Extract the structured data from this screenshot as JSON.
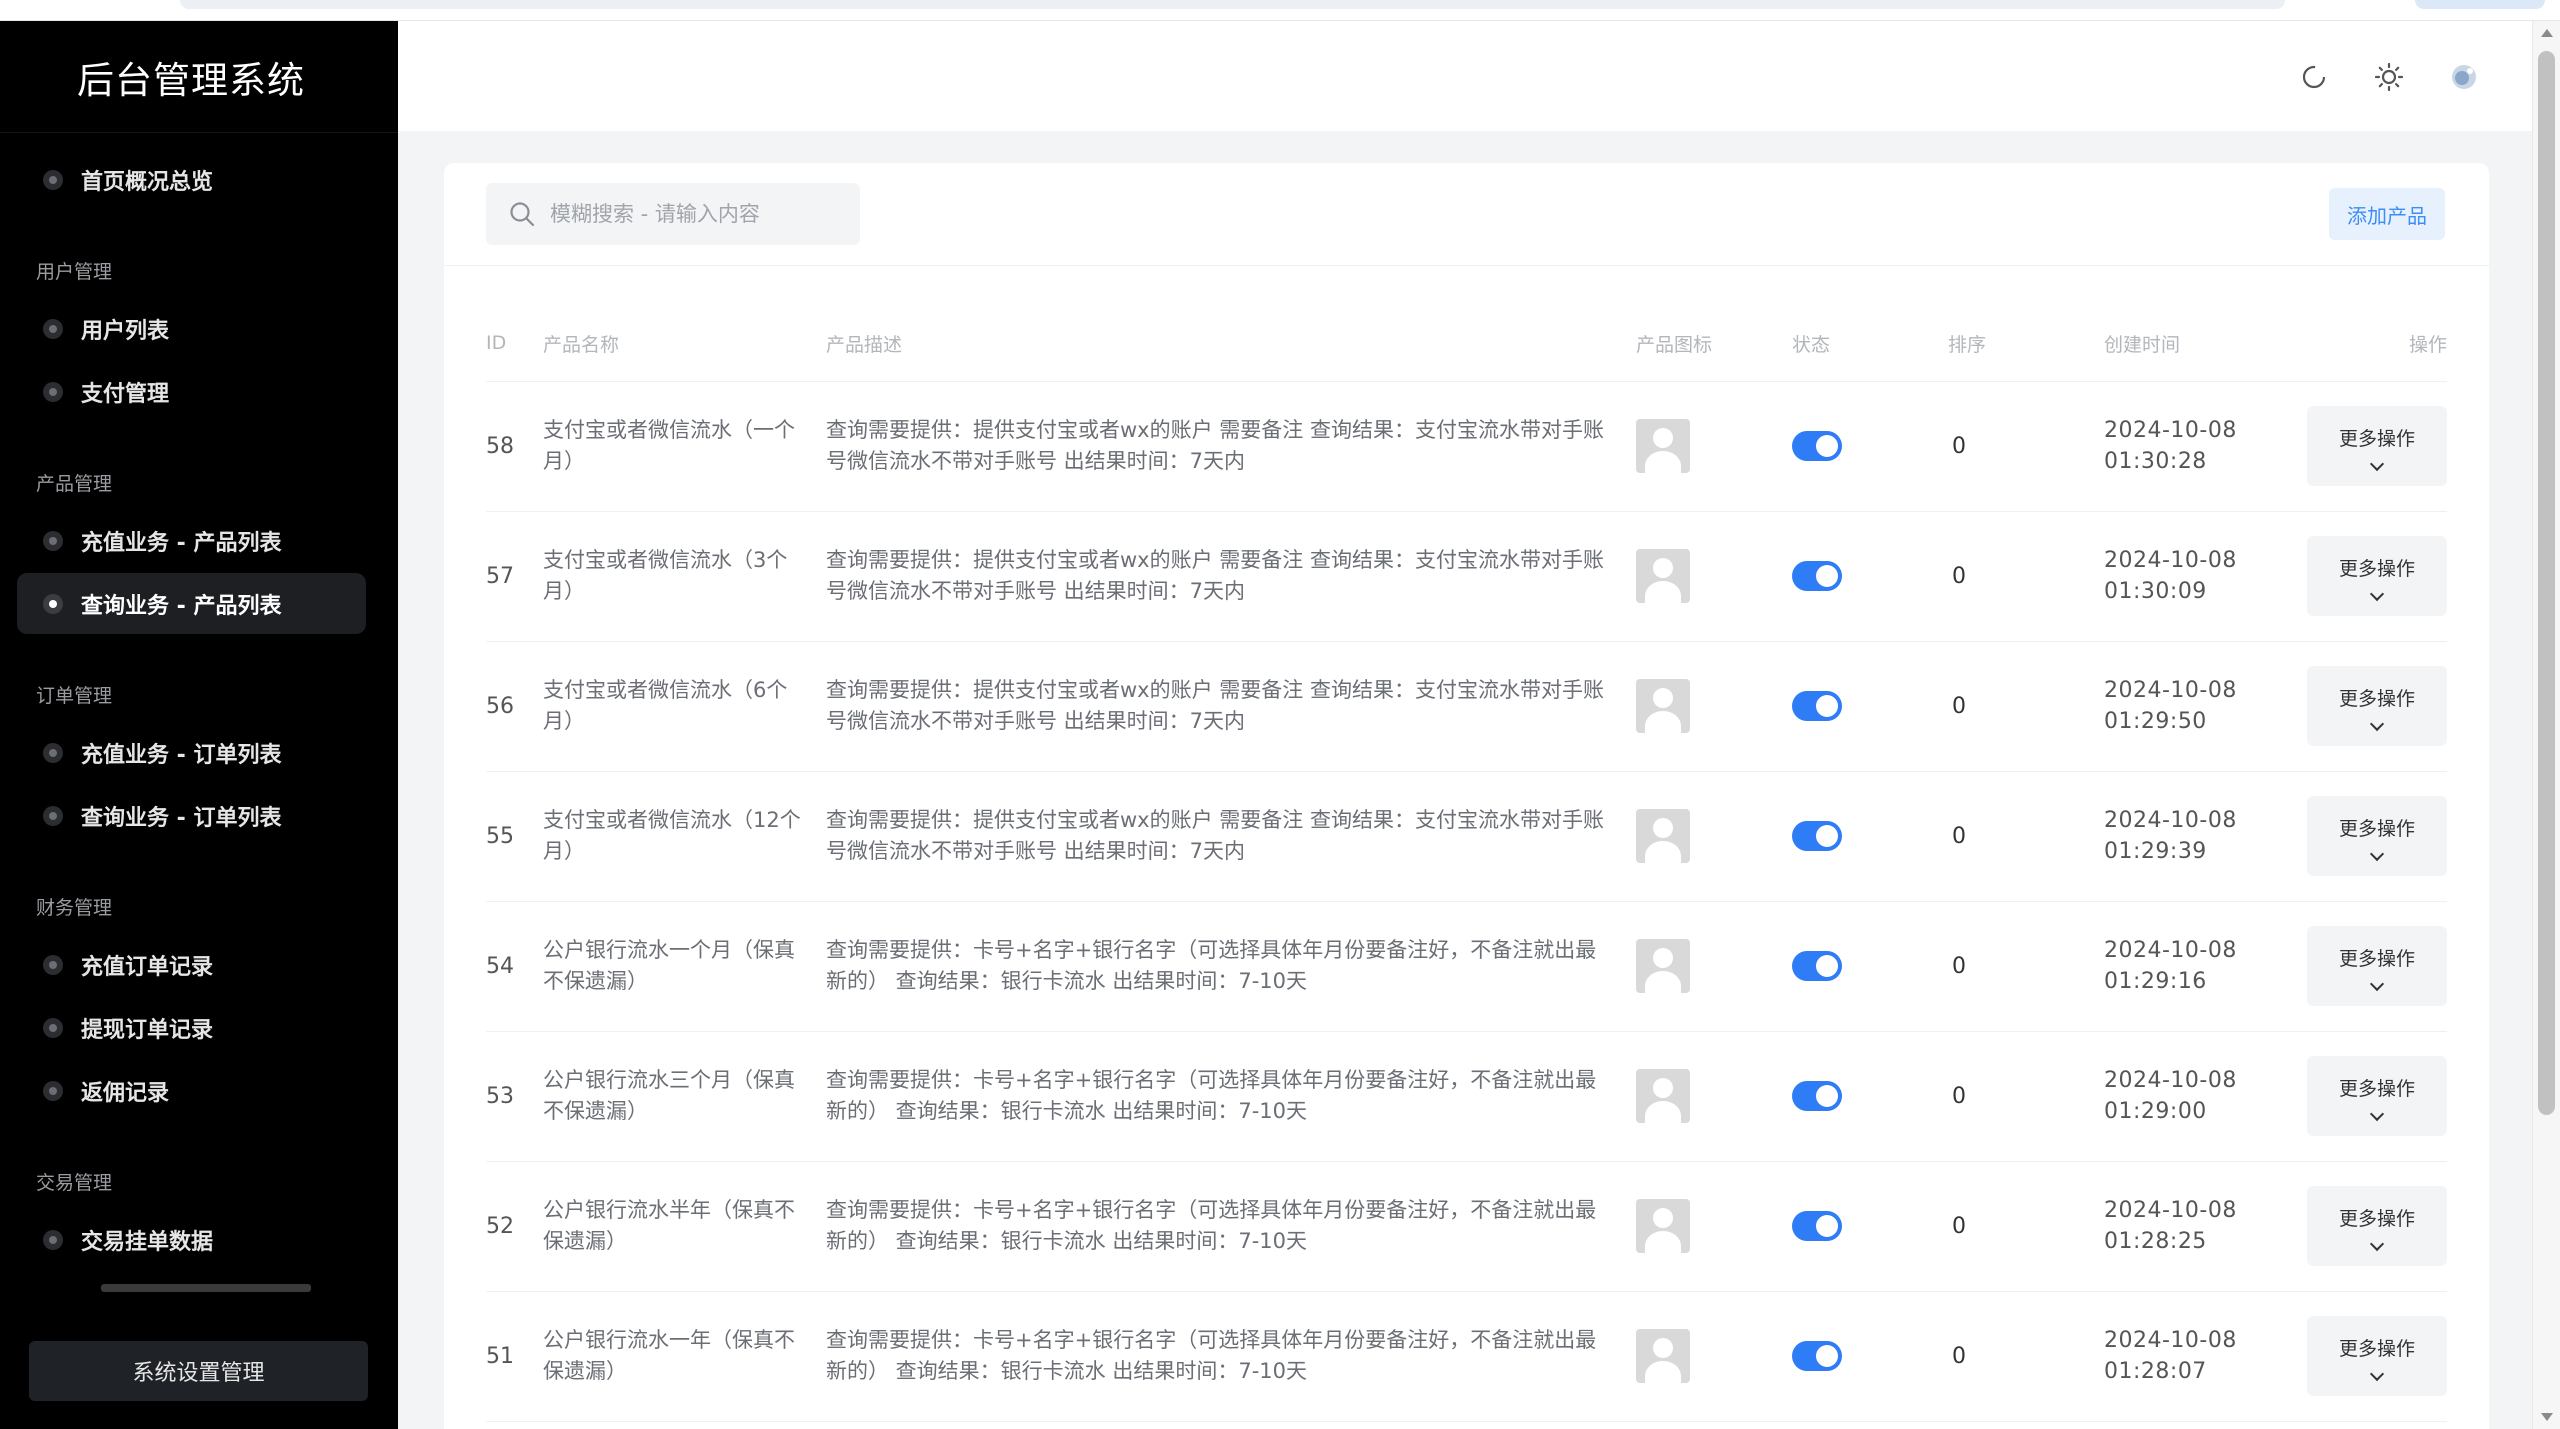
{
  "brand": {
    "title": "后台管理系统"
  },
  "sidebar": {
    "home": "首页概况总览",
    "groups": [
      {
        "title": "用户管理",
        "items": [
          "用户列表",
          "支付管理"
        ]
      },
      {
        "title": "产品管理",
        "items": [
          "充值业务 - 产品列表",
          "查询业务 - 产品列表"
        ]
      },
      {
        "title": "订单管理",
        "items": [
          "充值业务 - 订单列表",
          "查询业务 - 订单列表"
        ]
      },
      {
        "title": "财务管理",
        "items": [
          "充值订单记录",
          "提现订单记录",
          "返佣记录"
        ]
      },
      {
        "title": "交易管理",
        "items": [
          "交易挂单数据"
        ]
      }
    ],
    "active": "查询业务 - 产品列表",
    "settings_button": "系统设置管理"
  },
  "header": {
    "icons": [
      "refresh-icon",
      "sun-icon",
      "avatar-icon"
    ]
  },
  "toolbar": {
    "search_placeholder": "模糊搜索 - 请输入内容",
    "add_button": "添加产品"
  },
  "table": {
    "columns": [
      "ID",
      "产品名称",
      "产品描述",
      "产品图标",
      "状态",
      "排序",
      "创建时间",
      "操作"
    ],
    "more_label": "更多操作",
    "rows": [
      {
        "id": "58",
        "name": "支付宝或者微信流水（一个月）",
        "desc": "查询需要提供：提供支付宝或者wx的账户 需要备注 查询结果：支付宝流水带对手账号微信流水不带对手账号 出结果时间：7天内",
        "sort": "0",
        "date": "2024-10-08",
        "time": "01:30:28",
        "status": true
      },
      {
        "id": "57",
        "name": "支付宝或者微信流水（3个月）",
        "desc": "查询需要提供：提供支付宝或者wx的账户 需要备注 查询结果：支付宝流水带对手账号微信流水不带对手账号 出结果时间：7天内",
        "sort": "0",
        "date": "2024-10-08",
        "time": "01:30:09",
        "status": true
      },
      {
        "id": "56",
        "name": "支付宝或者微信流水（6个月）",
        "desc": "查询需要提供：提供支付宝或者wx的账户 需要备注 查询结果：支付宝流水带对手账号微信流水不带对手账号 出结果时间：7天内",
        "sort": "0",
        "date": "2024-10-08",
        "time": "01:29:50",
        "status": true
      },
      {
        "id": "55",
        "name": "支付宝或者微信流水（12个月）",
        "desc": "查询需要提供：提供支付宝或者wx的账户 需要备注 查询结果：支付宝流水带对手账号微信流水不带对手账号 出结果时间：7天内",
        "sort": "0",
        "date": "2024-10-08",
        "time": "01:29:39",
        "status": true
      },
      {
        "id": "54",
        "name": "公户银行流水一个月（保真不保遗漏）",
        "desc": "查询需要提供：卡号+名字+银行名字（可选择具体年月份要备注好，不备注就出最新的） 查询结果：银行卡流水 出结果时间：7-10天",
        "sort": "0",
        "date": "2024-10-08",
        "time": "01:29:16",
        "status": true
      },
      {
        "id": "53",
        "name": "公户银行流水三个月（保真不保遗漏）",
        "desc": "查询需要提供：卡号+名字+银行名字（可选择具体年月份要备注好，不备注就出最新的） 查询结果：银行卡流水 出结果时间：7-10天",
        "sort": "0",
        "date": "2024-10-08",
        "time": "01:29:00",
        "status": true
      },
      {
        "id": "52",
        "name": "公户银行流水半年（保真不保遗漏）",
        "desc": "查询需要提供：卡号+名字+银行名字（可选择具体年月份要备注好，不备注就出最新的） 查询结果：银行卡流水 出结果时间：7-10天",
        "sort": "0",
        "date": "2024-10-08",
        "time": "01:28:25",
        "status": true
      },
      {
        "id": "51",
        "name": "公户银行流水一年（保真不保遗漏）",
        "desc": "查询需要提供：卡号+名字+银行名字（可选择具体年月份要备注好，不备注就出最新的） 查询结果：银行卡流水 出结果时间：7-10天",
        "sort": "0",
        "date": "2024-10-08",
        "time": "01:28:07",
        "status": true
      }
    ]
  },
  "colors": {
    "accent": "#2e7cf6",
    "sidebar_bg": "#000000",
    "add_button_bg": "#e7f0fd"
  }
}
